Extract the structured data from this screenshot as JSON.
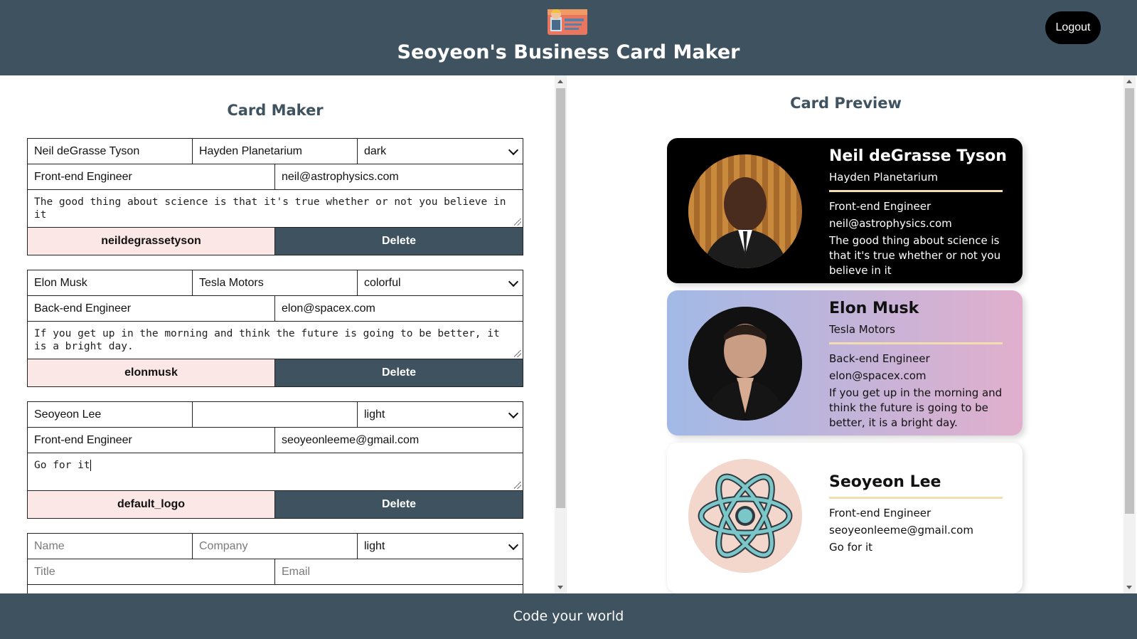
{
  "header": {
    "title": "Seoyeon's Business Card Maker",
    "logout_label": "Logout"
  },
  "maker": {
    "title": "Card Maker",
    "cards": [
      {
        "name": "Neil deGrasse Tyson",
        "company": "Hayden Planetarium",
        "theme": "dark",
        "title": "Front-end Engineer",
        "email": "neil@astrophysics.com",
        "message": "The good thing about science is that it's true whether or not you believe in it",
        "file": "neildegrassetyson",
        "delete": "Delete"
      },
      {
        "name": "Elon Musk",
        "company": "Tesla Motors",
        "theme": "colorful",
        "title": "Back-end Engineer",
        "email": "elon@spacex.com",
        "message": "If you get up in the morning and think the future is going to be better, it is a bright day.",
        "file": "elonmusk",
        "delete": "Delete"
      },
      {
        "name": "Seoyeon Lee",
        "company": "",
        "theme": "light",
        "title": "Front-end Engineer",
        "email": "seoyeonleeme@gmail.com",
        "message": "Go for it",
        "file": "default_logo",
        "delete": "Delete"
      }
    ],
    "new_form": {
      "name_placeholder": "Name",
      "company_placeholder": "Company",
      "theme": "light",
      "title_placeholder": "Title",
      "email_placeholder": "Email"
    }
  },
  "preview": {
    "title": "Card Preview",
    "cards": [
      {
        "name": "Neil deGrasse Tyson",
        "company": "Hayden Planetarium",
        "title": "Front-end Engineer",
        "email": "neil@astrophysics.com",
        "message": "The good thing about science is that it's true whether or not you believe in it"
      },
      {
        "name": "Elon Musk",
        "company": "Tesla Motors",
        "title": "Back-end Engineer",
        "email": "elon@spacex.com",
        "message": "If you get up in the morning and think the future is going to be better, it is a bright day."
      },
      {
        "name": "Seoyeon Lee",
        "company": "",
        "title": "Front-end Engineer",
        "email": "seoyeonleeme@gmail.com",
        "message": "Go for it"
      }
    ]
  },
  "footer": {
    "text": "Code your world"
  },
  "colors": {
    "primary": "#3f5260",
    "file_button": "#fbe7e6",
    "accent_line": "#f1ddb0"
  }
}
